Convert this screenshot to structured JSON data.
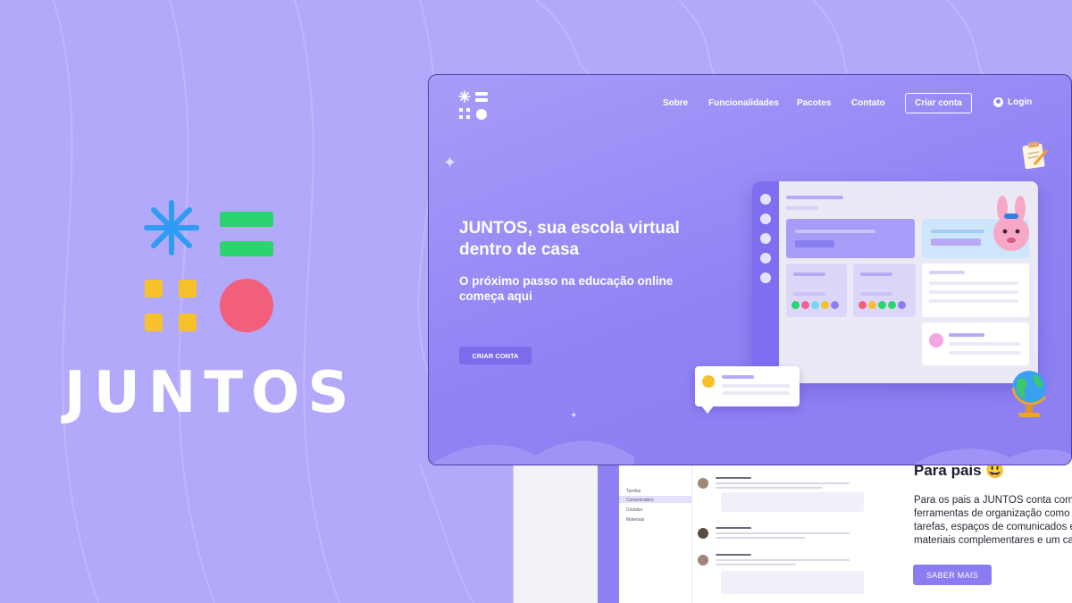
{
  "brand": {
    "name": "JUNTOS",
    "colors": {
      "asterisk": "#2f9bf2",
      "bars": "#2ad46e",
      "squares": "#f7c12a",
      "circle": "#f25f7a"
    }
  },
  "main_window": {
    "nav": [
      {
        "label": "Sobre"
      },
      {
        "label": "Funcionalidades"
      },
      {
        "label": "Pacotes"
      },
      {
        "label": "Contato"
      }
    ],
    "cta_label": "Criar conta",
    "login_label": "Login",
    "headline": "JUNTOS, sua escola virtual dentro de casa",
    "subheadline": "O próximo passo na educação online começa aqui",
    "primary_button": "CRIAR CONTA",
    "icons": [
      "user-icon",
      "clipboard-icon",
      "globe-icon",
      "bunny-mascot-icon"
    ]
  },
  "back_window": {
    "nav_items": [
      "Tarefas",
      "Comunicados",
      "Dúvidas",
      "Materiais"
    ],
    "section_title": "Para pais 😃",
    "section_text": "Para os pais a JUNTOS conta com di ferramentas de organização como u tarefas, espaços de comunicados e materiais complementares e um cale",
    "button": "SABER MAIS"
  },
  "colors": {
    "background": "#b3a9fb",
    "primary": "#8f82f4",
    "button": "#7a6cea"
  }
}
